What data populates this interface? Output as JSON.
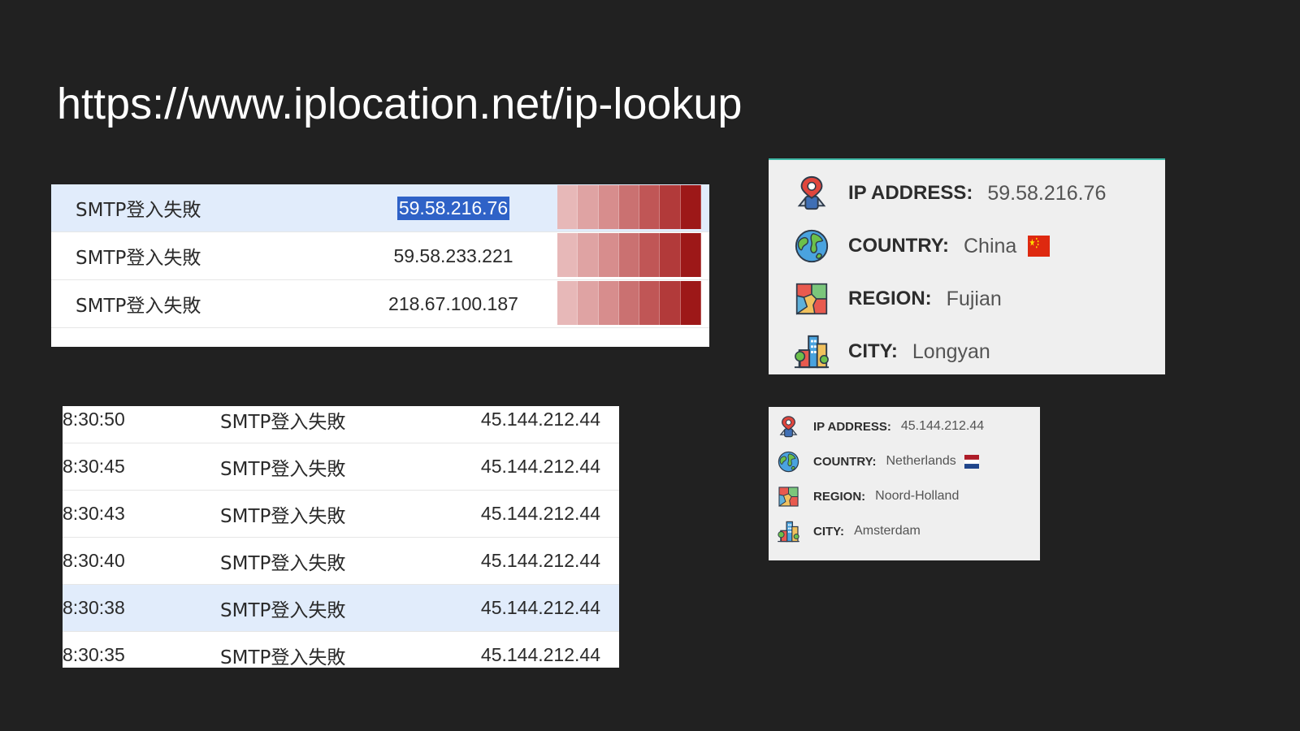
{
  "title": "https://www.iplocation.net/ip-lookup",
  "table1": {
    "rows": [
      {
        "event": "SMTP登入失敗",
        "ip": "59.58.216.76",
        "selected": true
      },
      {
        "event": "SMTP登入失敗",
        "ip": "59.58.233.221",
        "selected": false
      },
      {
        "event": "SMTP登入失敗",
        "ip": "218.67.100.187",
        "selected": false
      }
    ],
    "heatmap_colors": [
      "#e7b8b8",
      "#dfa3a3",
      "#d78d8d",
      "#ca7171",
      "#c05656",
      "#b23a3a",
      "#9d1818"
    ]
  },
  "table2": {
    "rows": [
      {
        "time": "8:30:50",
        "event": "SMTP登入失敗",
        "ip": "45.144.212.44"
      },
      {
        "time": "8:30:45",
        "event": "SMTP登入失敗",
        "ip": "45.144.212.44"
      },
      {
        "time": "8:30:43",
        "event": "SMTP登入失敗",
        "ip": "45.144.212.44"
      },
      {
        "time": "8:30:40",
        "event": "SMTP登入失敗",
        "ip": "45.144.212.44"
      },
      {
        "time": "8:30:38",
        "event": "SMTP登入失敗",
        "ip": "45.144.212.44",
        "selected": true
      },
      {
        "time": "8:30:35",
        "event": "SMTP登入失敗",
        "ip": "45.144.212.44"
      }
    ]
  },
  "card_china": {
    "ip_label": "IP ADDRESS:",
    "ip_value": "59.58.216.76",
    "country_label": "COUNTRY:",
    "country_value": "China",
    "region_label": "REGION:",
    "region_value": "Fujian",
    "city_label": "CITY:",
    "city_value": "Longyan",
    "icons": [
      "location-pin-person-icon",
      "globe-icon",
      "map-icon",
      "city-buildings-icon",
      "china-flag-icon"
    ]
  },
  "card_netherlands": {
    "ip_label": "IP ADDRESS:",
    "ip_value": "45.144.212.44",
    "country_label": "COUNTRY:",
    "country_value": "Netherlands",
    "region_label": "REGION:",
    "region_value": "Noord-Holland",
    "city_label": "CITY:",
    "city_value": "Amsterdam",
    "icons": [
      "location-pin-person-icon",
      "globe-icon",
      "map-icon",
      "city-buildings-icon",
      "netherlands-flag-icon"
    ]
  },
  "accent_colors": {
    "background": "#212121",
    "selection_row": "#e1ecfb",
    "text_selection": "#2f62c7",
    "card_border": "#3fb8a6"
  }
}
